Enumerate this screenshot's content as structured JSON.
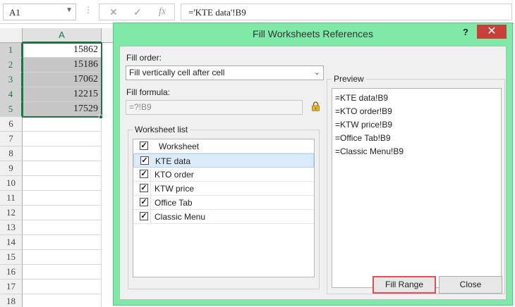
{
  "formula_bar": {
    "name_box": "A1",
    "dots": "⋮",
    "cancel_glyph": "✕",
    "enter_glyph": "✓",
    "fx_glyph": "fx",
    "formula": "='KTE data'!B9"
  },
  "sheet": {
    "column_header": "A",
    "rows": [
      {
        "n": "1",
        "value": "15862"
      },
      {
        "n": "2",
        "value": "15186"
      },
      {
        "n": "3",
        "value": "17062"
      },
      {
        "n": "4",
        "value": "12215"
      },
      {
        "n": "5",
        "value": "17529"
      },
      {
        "n": "6",
        "value": ""
      },
      {
        "n": "7",
        "value": ""
      },
      {
        "n": "8",
        "value": ""
      },
      {
        "n": "9",
        "value": ""
      },
      {
        "n": "10",
        "value": ""
      },
      {
        "n": "11",
        "value": ""
      },
      {
        "n": "12",
        "value": ""
      },
      {
        "n": "13",
        "value": ""
      },
      {
        "n": "14",
        "value": ""
      },
      {
        "n": "15",
        "value": ""
      },
      {
        "n": "16",
        "value": ""
      },
      {
        "n": "17",
        "value": ""
      },
      {
        "n": "18",
        "value": ""
      }
    ]
  },
  "dialog": {
    "title": "Fill Worksheets References",
    "help": "?",
    "close": "✕",
    "fill_order_label": "Fill order:",
    "fill_order_value": "Fill vertically cell after cell",
    "fill_formula_label": "Fill formula:",
    "fill_formula_value": "=?!B9",
    "worksheet_list_label": "Worksheet list",
    "worksheet_header": "Worksheet",
    "worksheets": [
      {
        "name": "KTE data",
        "checked": true
      },
      {
        "name": "KTO order",
        "checked": true
      },
      {
        "name": "KTW price",
        "checked": true
      },
      {
        "name": "Office Tab",
        "checked": true
      },
      {
        "name": "Classic Menu",
        "checked": true
      }
    ],
    "preview_label": "Preview",
    "preview_lines": [
      "=KTE data!B9",
      "=KTO order!B9",
      "=KTW price!B9",
      "=Office Tab!B9",
      "=Classic Menu!B9"
    ],
    "fill_range_button": "Fill Range",
    "close_button": "Close",
    "colors": {
      "frame": "#7fe9a8",
      "close_bg": "#c8403a",
      "highlight_border": "#e84d55",
      "selection": "#217346"
    }
  }
}
